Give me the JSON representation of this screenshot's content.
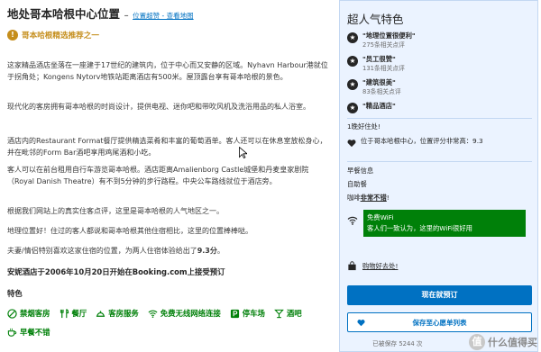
{
  "header": {
    "title": "地处哥本哈根中心位置",
    "dash": "–",
    "link": "位置超赞 - 查看地图"
  },
  "recommendation": {
    "icon": "!",
    "text": "哥本哈根精选推荐之一"
  },
  "description": {
    "p1": "这家精品酒店坐落在一座建于17世纪的建筑内，位于中心而又安静的区域。Nyhavn Harbour港就位于拐角处；Kongens Nytorv地铁站距离酒店有500米。屋顶露台享有哥本哈根的景色。",
    "p2": "现代化的客房拥有哥本哈根的时尚设计，提供电视、迷你吧和带吹风机及洗浴用品的私人浴室。",
    "p3": "酒店内的Restaurant Format餐厅提供精选菜肴和丰富的葡萄酒单。客人还可以在休息室放松身心，并在毗邻的Form Bar酒吧享用鸡尾酒和小吃。",
    "p4": "客人可以在前台租用自行车游览哥本哈根。酒店距离Amalienborg Castle城堡和丹麦皇家剧院（Royal Danish Theatre）有不到5分钟的步行路程。中央公车路线就位于酒店旁。",
    "p5": "根据我们网站上的真实住客点评，这里是哥本哈根的人气地区之一。",
    "p6": "地理位置好！住过的客人都说和哥本哈根其他住宿相比，这里的位置棒棒哒。",
    "p7_prefix": "夫妻/情侣特别喜欢这家住宿的位置，为两人住宿体验给出了",
    "p7_score": "9.3分",
    "p7_suffix": "。",
    "since": "安妮酒店于2006年10月20日开始在Booking.com上接受预订"
  },
  "features": {
    "heading": "特色",
    "items": [
      {
        "icon": "no-smoking-icon",
        "label": "禁烟客房"
      },
      {
        "icon": "restaurant-icon",
        "label": "餐厅"
      },
      {
        "icon": "room-service-icon",
        "label": "客房服务"
      },
      {
        "icon": "wifi-icon",
        "label": "免费无线网络连接"
      },
      {
        "icon": "parking-icon",
        "label": "停车场"
      },
      {
        "icon": "bar-icon",
        "label": "酒吧"
      },
      {
        "icon": "breakfast-icon",
        "label": "早餐不错"
      }
    ]
  },
  "sidebar": {
    "title": "超人气特色",
    "highlights": [
      {
        "label": "\"地理位置很便利\"",
        "sub": "275条相关点评"
      },
      {
        "label": "\"员工很赞\"",
        "sub": "131条相关点评"
      },
      {
        "label": "\"建筑很美\"",
        "sub": "83条相关点评"
      },
      {
        "label": "\"精品酒店\"",
        "sub": ""
      }
    ],
    "stay_title": "1晚好住处!",
    "location_text": "位于哥本哈根中心，位置评分非常高：9.3",
    "breakfast_title": "早餐信息",
    "breakfast_value": "自助餐",
    "coffee_prefix": "咖啡",
    "coffee_value": "非常不错",
    "coffee_suffix": "!",
    "wifi_title": "免费WiFi",
    "wifi_text": "客人们一致认为，这里的WiFi很好用",
    "shopping_text": "购物好去处!",
    "book_button": "现在就预订",
    "save_button": "保存至心愿单列表",
    "saved_text": "已被保存 5244 次"
  },
  "watermark": {
    "circle": "值",
    "text": "什么值得买"
  },
  "colors": {
    "accent": "#0071c2",
    "green": "#008009",
    "gold": "#c58e1c",
    "panel": "#ebf3ff"
  }
}
